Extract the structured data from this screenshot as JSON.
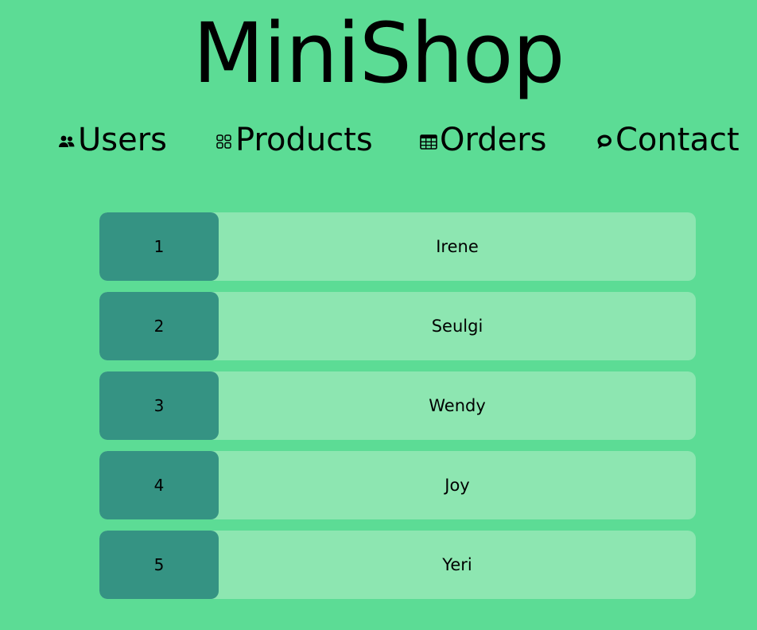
{
  "app": {
    "title": "MiniShop"
  },
  "nav": {
    "items": [
      {
        "label": "Users",
        "icon": "users-icon"
      },
      {
        "label": "Products",
        "icon": "grid-icon"
      },
      {
        "label": "Orders",
        "icon": "table-icon"
      },
      {
        "label": "Contact",
        "icon": "chat-icon"
      }
    ]
  },
  "users": {
    "rows": [
      {
        "id": "1",
        "name": "Irene"
      },
      {
        "id": "2",
        "name": "Seulgi"
      },
      {
        "id": "3",
        "name": "Wendy"
      },
      {
        "id": "4",
        "name": "Joy"
      },
      {
        "id": "5",
        "name": "Yeri"
      }
    ]
  },
  "colors": {
    "background": "#5cdc95",
    "row_background": "#8de6b1",
    "id_background": "#359383",
    "text": "#000000"
  }
}
